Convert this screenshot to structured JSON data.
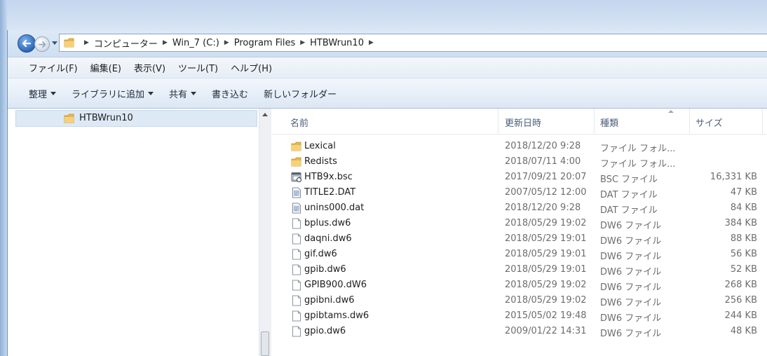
{
  "address": {
    "crumbs": [
      "コンピューター",
      "Win_7 (C:)",
      "Program Files",
      "HTBWrun10"
    ]
  },
  "menu": [
    "ファイル(F)",
    "編集(E)",
    "表示(V)",
    "ツール(T)",
    "ヘルプ(H)"
  ],
  "toolbar": [
    {
      "label": "整理",
      "dropdown": true
    },
    {
      "label": "ライブラリに追加",
      "dropdown": true
    },
    {
      "label": "共有",
      "dropdown": true
    },
    {
      "label": "書き込む",
      "dropdown": false
    },
    {
      "label": "新しいフォルダー",
      "dropdown": false
    }
  ],
  "nav": {
    "selected_folder": "HTBWrun10"
  },
  "columns": {
    "name": "名前",
    "date": "更新日時",
    "type": "種類",
    "size": "サイズ"
  },
  "files": [
    {
      "name": "Lexical",
      "date": "2018/12/20 9:28",
      "type": "ファイル フォル...",
      "size": "",
      "icon": "folder-icon"
    },
    {
      "name": "Redists",
      "date": "2018/07/11 4:00",
      "type": "ファイル フォル...",
      "size": "",
      "icon": "folder-icon"
    },
    {
      "name": "HTB9x.bsc",
      "date": "2017/09/21 20:07",
      "type": "BSC ファイル",
      "size": "16,331 KB",
      "icon": "bsc-file-icon"
    },
    {
      "name": "TITLE2.DAT",
      "date": "2007/05/12 12:00",
      "type": "DAT ファイル",
      "size": "47 KB",
      "icon": "text-file-icon"
    },
    {
      "name": "unins000.dat",
      "date": "2018/12/20 9:28",
      "type": "DAT ファイル",
      "size": "84 KB",
      "icon": "text-file-icon"
    },
    {
      "name": "bplus.dw6",
      "date": "2018/05/29 19:02",
      "type": "DW6 ファイル",
      "size": "384 KB",
      "icon": "blank-file-icon"
    },
    {
      "name": "daqni.dw6",
      "date": "2018/05/29 19:01",
      "type": "DW6 ファイル",
      "size": "88 KB",
      "icon": "blank-file-icon"
    },
    {
      "name": "gif.dw6",
      "date": "2018/05/29 19:01",
      "type": "DW6 ファイル",
      "size": "56 KB",
      "icon": "blank-file-icon"
    },
    {
      "name": "gpib.dw6",
      "date": "2018/05/29 19:01",
      "type": "DW6 ファイル",
      "size": "52 KB",
      "icon": "blank-file-icon"
    },
    {
      "name": "GPIB900.dW6",
      "date": "2018/05/29 19:02",
      "type": "DW6 ファイル",
      "size": "268 KB",
      "icon": "blank-file-icon"
    },
    {
      "name": "gpibni.dw6",
      "date": "2018/05/29 19:02",
      "type": "DW6 ファイル",
      "size": "256 KB",
      "icon": "blank-file-icon"
    },
    {
      "name": "gpibtams.dw6",
      "date": "2015/05/02 19:48",
      "type": "DW6 ファイル",
      "size": "244 KB",
      "icon": "blank-file-icon"
    },
    {
      "name": "gpio.dw6",
      "date": "2009/01/22 14:31",
      "type": "DW6 ファイル",
      "size": "48 KB",
      "icon": "blank-file-icon"
    }
  ]
}
